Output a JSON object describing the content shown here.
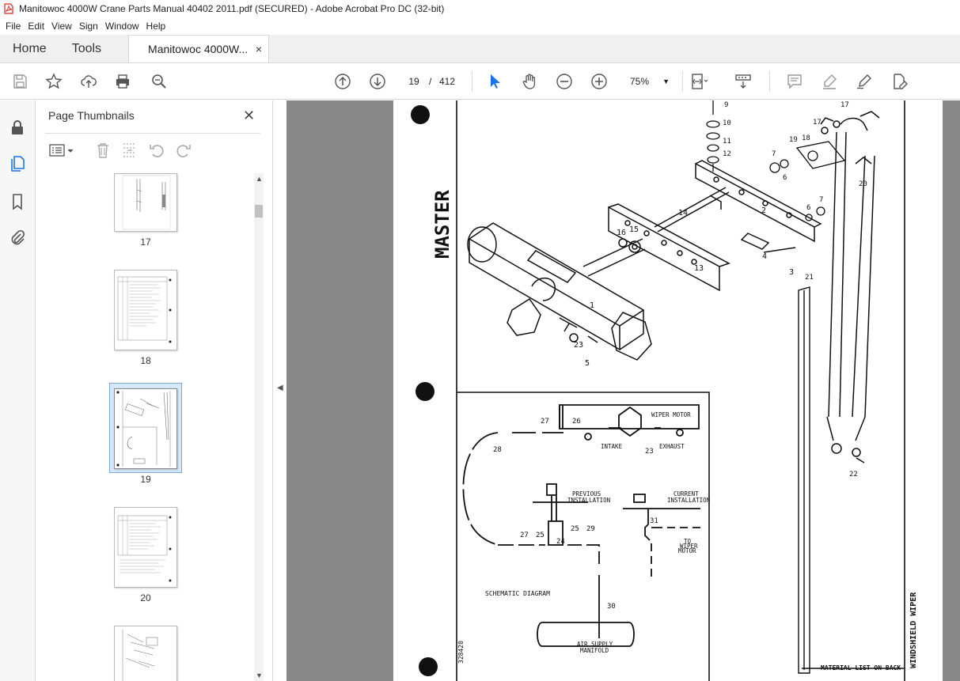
{
  "window": {
    "title": "Manitowoc 4000W Crane Parts Manual 40402 2011.pdf (SECURED) - Adobe Acrobat Pro DC (32-bit)"
  },
  "menu": {
    "items": [
      "File",
      "Edit",
      "View",
      "Sign",
      "Window",
      "Help"
    ]
  },
  "tabs": {
    "home": "Home",
    "tools": "Tools",
    "document": "Manitowoc 4000W...",
    "close": "×"
  },
  "toolbar": {
    "current_page": "19",
    "separator": "/",
    "total_pages": "412",
    "zoom": "75%"
  },
  "panel": {
    "title": "Page Thumbnails",
    "close": "✕",
    "thumbnails": [
      {
        "label": "17",
        "selected": false
      },
      {
        "label": "18",
        "selected": false
      },
      {
        "label": "19",
        "selected": true
      },
      {
        "label": "20",
        "selected": false
      },
      {
        "label": "",
        "selected": false
      }
    ]
  },
  "document": {
    "vertical_title": "MASTER",
    "schematic_label": "SCHEMATIC DIAGRAM",
    "wiper_motor": "WIPER MOTOR",
    "intake": "INTAKE",
    "exhaust": "EXHAUST",
    "previous_installation_1": "PREVIOUS",
    "previous_installation_2": "INSTALLATION",
    "current_installation_1": "CURRENT",
    "current_installation_2": "INSTALLATION",
    "to_wiper_motor_1": "TO",
    "to_wiper_motor_2": "WIPER",
    "to_wiper_motor_3": "MOTOR",
    "air_supply_1": "AIR SUPPLY",
    "air_supply_2": "MANIFOLD",
    "material_list": "MATERIAL LIST ON BACK",
    "side_title": "WINDSHIELD WIPER",
    "drawing_number": "328420"
  }
}
